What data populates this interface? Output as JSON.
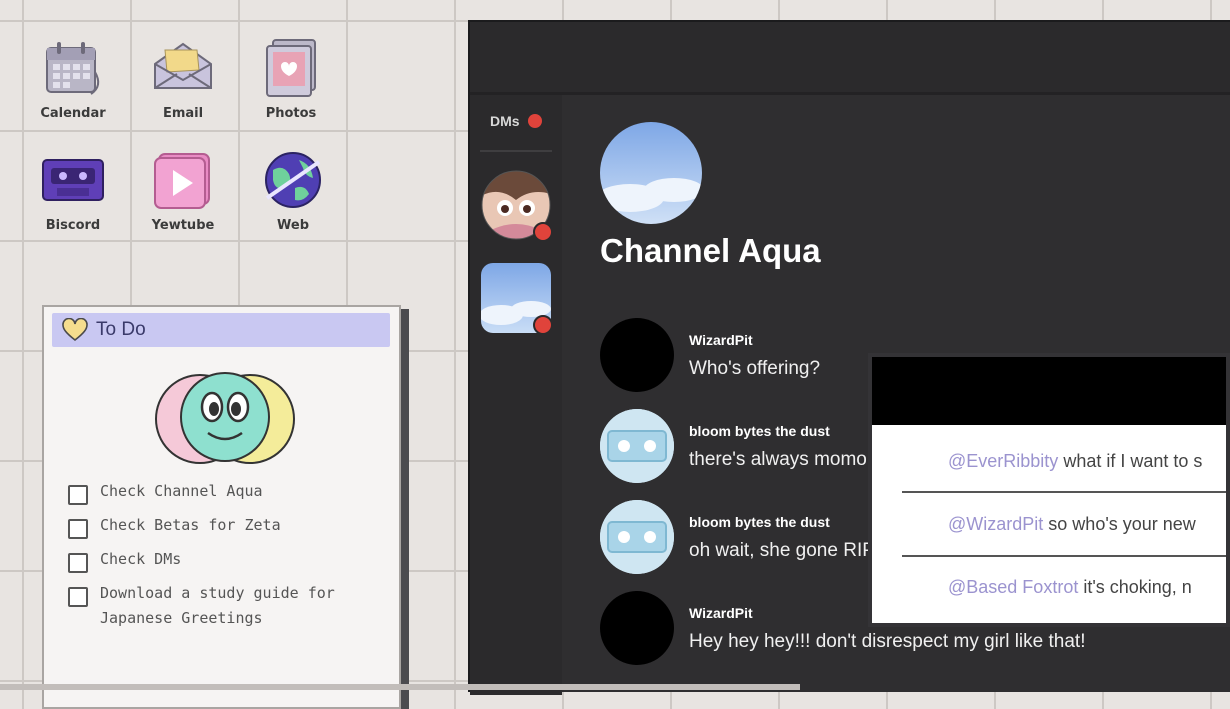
{
  "desktop": {
    "icons": [
      {
        "label": "Calendar",
        "icon": "calendar-icon"
      },
      {
        "label": "Email",
        "icon": "email-icon"
      },
      {
        "label": "Photos",
        "icon": "photos-icon"
      },
      {
        "label": "Biscord",
        "icon": "biscord-icon"
      },
      {
        "label": "Yewtube",
        "icon": "yewtube-icon"
      },
      {
        "label": "Web",
        "icon": "web-globe-icon"
      }
    ]
  },
  "todo": {
    "title": "To Do",
    "tasks": [
      {
        "label": "Check Channel Aqua",
        "checked": false
      },
      {
        "label": "Check Betas for Zeta",
        "checked": false
      },
      {
        "label": "Check DMs",
        "checked": false
      },
      {
        "label": "Download a study guide for Japanese Greetings",
        "checked": false
      }
    ]
  },
  "chat": {
    "sidebar": {
      "dms_label": "DMs"
    },
    "channel_name": "Channel Aqua",
    "messages": [
      {
        "user": "WizardPit",
        "text": "Who's offering?"
      },
      {
        "user": "bloom bytes the dust",
        "text": "there's always momo"
      },
      {
        "user": "bloom bytes the dust",
        "text": "oh wait, she gone RIP"
      },
      {
        "user": "WizardPit",
        "text": "Hey hey hey!!! don't disrespect my girl like that!"
      }
    ]
  },
  "popup": {
    "rows": [
      {
        "mention": "@EverRibbity",
        "text": " what if I want to s"
      },
      {
        "mention": "@WizardPit",
        "text": " so who's your new"
      },
      {
        "mention": "@Based Foxtrot",
        "text": " it's choking, n"
      }
    ]
  },
  "colors": {
    "background": "#e8e4e1",
    "chat_bg": "#2f2e30",
    "notification_red": "#e0433b",
    "mention": "#9b93cf",
    "todo_title_bg": "#c9c8f2"
  }
}
